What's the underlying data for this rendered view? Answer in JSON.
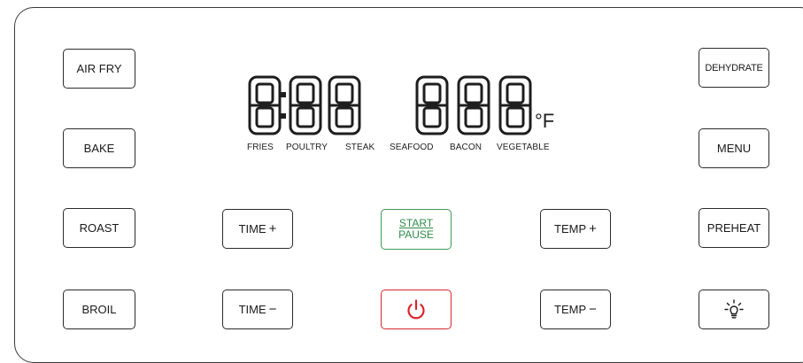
{
  "buttons": {
    "air_fry": "AIR FRY",
    "bake": "BAKE",
    "roast": "ROAST",
    "broil": "BROIL",
    "dehydrate": "DEHYDRATE",
    "menu": "MENU",
    "preheat": "PREHEAT",
    "time_plus": "TIME",
    "time_minus": "TIME",
    "temp_plus": "TEMP",
    "temp_minus": "TEMP",
    "start_line1": "START",
    "start_line2": "PAUSE",
    "plus_symbol": "+",
    "minus_symbol": "−"
  },
  "display": {
    "time_readout": "8:88",
    "temp_readout": "888",
    "unit": "°F"
  },
  "categories": [
    "FRIES",
    "POULTRY",
    "STEAK",
    "SEAFOOD",
    "BACON",
    "VEGETABLE"
  ],
  "icons": {
    "power": "power-icon",
    "light": "light-bulb-icon"
  },
  "colors": {
    "start_accent": "#2f8c49",
    "power_accent": "#d8262c",
    "segments": "#1e1e1e"
  }
}
